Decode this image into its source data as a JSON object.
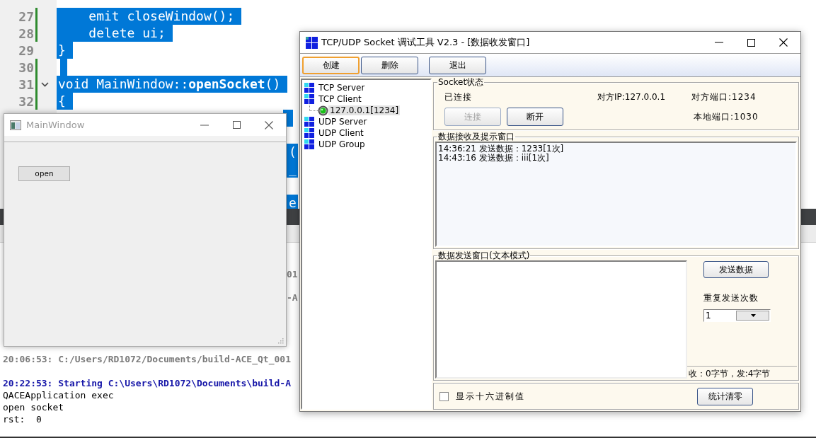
{
  "code_editor": {
    "lines": [
      {
        "number": "27",
        "code": "    emit closeWindow();",
        "selected": true,
        "changed": true,
        "foldable": false
      },
      {
        "number": "28",
        "code": "    delete ui;",
        "selected": true,
        "changed": true,
        "foldable": false
      },
      {
        "number": "29",
        "code": "}",
        "selected": true,
        "changed": false,
        "foldable": false
      },
      {
        "number": "30",
        "selected": true,
        "changed": true,
        "foldable": false
      },
      {
        "number": "31",
        "code": "void MainWindow::**openSocket**()",
        "selected": true,
        "changed": true,
        "foldable": true
      },
      {
        "number": "32",
        "code": "{",
        "selected": true,
        "changed": true,
        "foldable": false
      },
      {
        "selected": true
      },
      {
        "selected": false
      },
      {
        "selected": true,
        "tail": "("
      },
      {
        "selected": true,
        "tail": "_"
      },
      {
        "selected": false
      },
      {
        "selected": true,
        "tail": "e"
      }
    ]
  },
  "output_pane": {
    "covered_tails": [
      "01",
      "-A"
    ],
    "lines": [
      {
        "kind": "info",
        "text": "20:06:53: C:/Users/RD1072/Documents/build-ACE_Qt_001"
      },
      {
        "kind": "start",
        "text": "20:22:53: Starting C:\\Users\\RD1072\\Documents\\build-A"
      },
      {
        "kind": "plain",
        "text": "QACEApplication exec"
      },
      {
        "kind": "plain",
        "text": "open socket"
      },
      {
        "kind": "plain",
        "text": "rst:  0"
      }
    ]
  },
  "main_window": {
    "title": "MainWindow",
    "active": false,
    "open_button": "open"
  },
  "socket_tool": {
    "title": "TCP/UDP Socket 调试工具 V2.3 - [数据收发窗口]",
    "active": true,
    "toolbar": [
      {
        "label": "创建",
        "focused": true
      },
      {
        "label": "删除",
        "focused": false
      },
      {
        "label": "退出",
        "focused": false
      }
    ],
    "tree": [
      {
        "label": "TCP Server",
        "selected": false
      },
      {
        "label": "TCP Client",
        "selected": false,
        "children": [
          {
            "label": "127.0.0.1[1234]",
            "selected": true
          }
        ]
      },
      {
        "label": "UDP Server",
        "selected": false
      },
      {
        "label": "UDP Client",
        "selected": false
      },
      {
        "label": "UDP Group",
        "selected": false
      }
    ],
    "socket_status": {
      "legend": "Socket状态",
      "state": "已连接",
      "peer_ip": "对方IP:127.0.0.1",
      "peer_port": "对方端口:1234",
      "local_port": "本地端口:1030",
      "buttons": [
        {
          "label": "连接",
          "disabled": true
        },
        {
          "label": "断开",
          "disabled": false
        }
      ]
    },
    "receive": {
      "legend": "数据接收及提示窗口",
      "lines": [
        "14:36:21 发送数据：1233[1次]",
        "14:43:16 发送数据：iii[1次]"
      ]
    },
    "send": {
      "legend": "数据发送窗口(文本模式)",
      "send_button": "发送数据",
      "repeat_label": "重复发送次数",
      "repeat_value": "1",
      "counter": "收：0字节，发:4字节"
    },
    "options": {
      "hex_label": "显示十六进制值",
      "hex_checked": false,
      "reset_button": "统计清零"
    }
  }
}
